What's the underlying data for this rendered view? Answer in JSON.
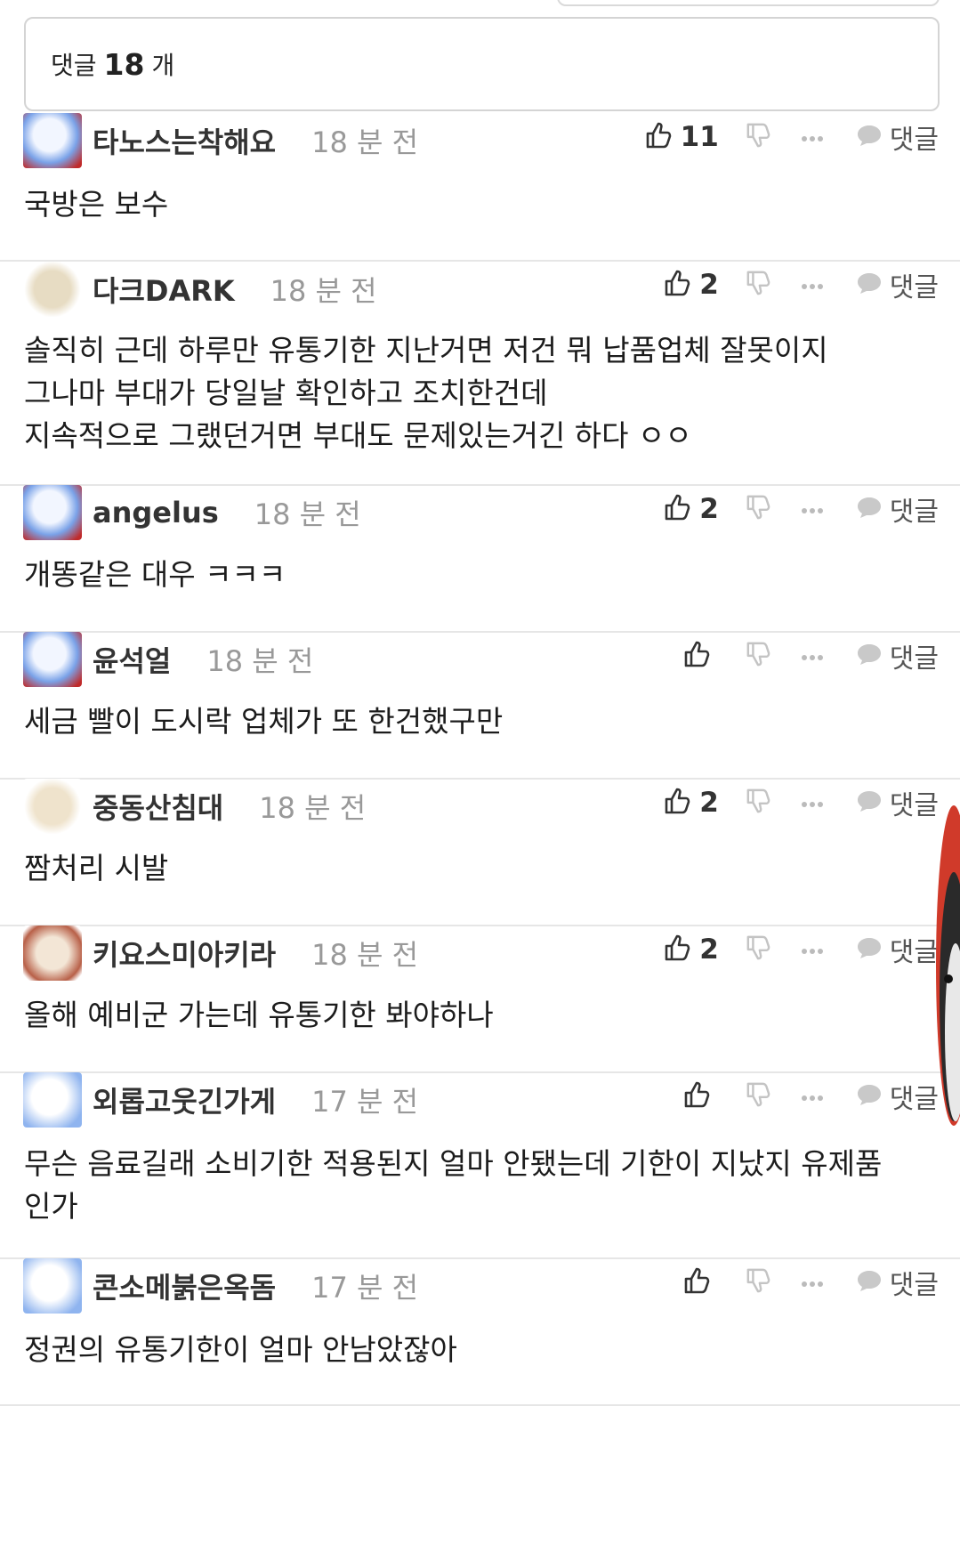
{
  "comment_count": {
    "prefix": "댓글",
    "count": "18",
    "suffix": "개"
  },
  "reply_label": "댓글",
  "comments": [
    {
      "nick": "타노스는착해요",
      "time": "18 분 전",
      "likes": "11",
      "text": "국방은 보수"
    },
    {
      "nick": "다크DARK",
      "time": "18 분 전",
      "likes": "2",
      "text": "솔직히 근데 하루만 유통기한 지난거면 저건 뭐 납품업체 잘못이지\n그나마 부대가 당일날 확인하고 조치한건데\n지속적으로 그랬던거면 부대도 문제있는거긴 하다 ㅇㅇ"
    },
    {
      "nick": "angelus",
      "time": "18 분 전",
      "likes": "2",
      "text": "개똥같은 대우 ㅋㅋㅋ"
    },
    {
      "nick": "윤석얼",
      "time": "18 분 전",
      "likes": "",
      "text": "세금 빨이 도시락 업체가 또 한건했구만"
    },
    {
      "nick": "중동산침대",
      "time": "18 분 전",
      "likes": "2",
      "text": "짬처리 시발"
    },
    {
      "nick": "키요스미아키라",
      "time": "18 분 전",
      "likes": "2",
      "text": "올해 예비군 가는데 유통기한 봐야하나"
    },
    {
      "nick": "외롭고웃긴가게",
      "time": "17 분 전",
      "likes": "",
      "text": "무슨 음료길래 소비기한 적용된지 얼마 안됐는데 기한이 지났지 유제품\n인가"
    },
    {
      "nick": "콘소메붉은옥돔",
      "time": "17 분 전",
      "likes": "",
      "text": "정권의 유통기한이 얼마 안남았잖아"
    }
  ],
  "colors": {
    "border": "#d4d4d4",
    "divider": "#e6e6e6",
    "muted": "#999999",
    "icon": "#c4c4c4",
    "dark": "#333333"
  }
}
